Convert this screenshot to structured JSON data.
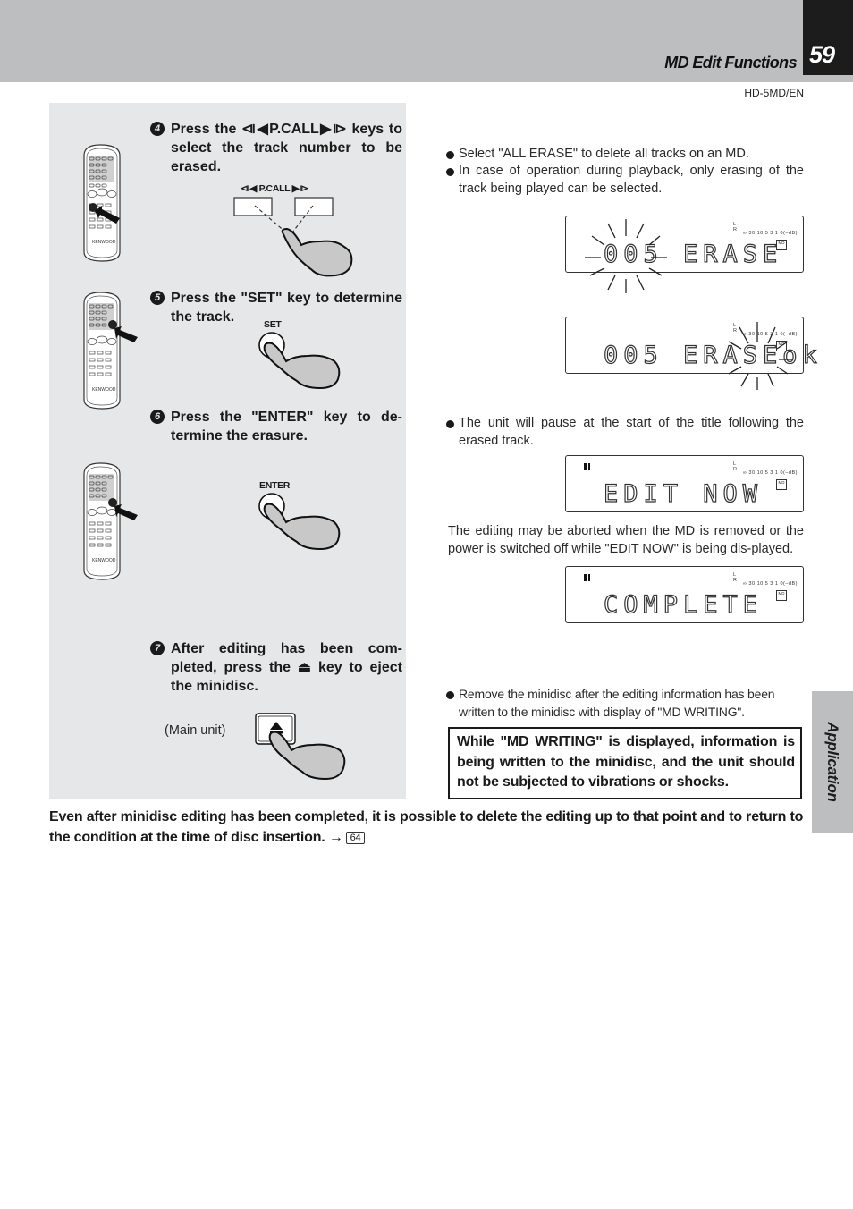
{
  "header": {
    "section_title": "MD Edit Functions",
    "page_number": "59",
    "model_code": "HD-5MD/EN"
  },
  "side_tab": {
    "label": "Application"
  },
  "steps": [
    {
      "number": "4",
      "text": "Press the ⧏◀P.CALL▶⧐ keys to select the track number to be erased.",
      "key_label": "⧏◀ P.CALL ▶⧐",
      "icon": "remote-control-icon"
    },
    {
      "number": "5",
      "text": "Press the \"SET\" key to determine the track.",
      "key_label": "SET",
      "icon": "remote-control-icon"
    },
    {
      "number": "6",
      "text": "Press the \"ENTER\" key to de-termine the erasure.",
      "key_label": "ENTER",
      "icon": "remote-control-icon"
    },
    {
      "number": "7",
      "text": "After editing has been com-pleted, press the ⏏ key to eject the minidisc.",
      "key_label": "⏏",
      "caption": "(Main unit)"
    }
  ],
  "notes": {
    "erase_bullets": [
      "Select \"ALL ERASE\" to delete all tracks on an MD.",
      "In case of operation during playback, only erasing of the track being played can be selected."
    ],
    "pause_bullet": "The unit will pause at the start of the title following the erased track.",
    "abort_paragraph": "The editing may be aborted when the MD is removed or the power is switched off while \"EDIT NOW\" is being dis-played.",
    "remove_bullet": "Remove the minidisc after the editing information has been written to the minidisc with display of \"MD WRITING\"."
  },
  "displays": [
    {
      "text": "005 ERASE",
      "blink": "005",
      "pause": false
    },
    {
      "text": "005 ERASEok",
      "blink": "ok",
      "pause": false
    },
    {
      "text": "EDIT NOW",
      "pause": true
    },
    {
      "text": "COMPLETE",
      "pause": true
    }
  ],
  "lcd_indicators": {
    "channels": "L\nR",
    "meter_scale": "∞ 30 10 5 3 1 0(–dB)",
    "md_badge": "MD"
  },
  "warning_box": "While \"MD WRITING\" is displayed, information is being written to the minidisc, and the unit should not be subjected to vibrations or shocks.",
  "footer": {
    "text": "Even after minidisc editing has been completed, it is possible to delete the editing up to that point and to return to the condition at the time of disc insertion.",
    "arrow": "→",
    "page_ref": "64"
  }
}
